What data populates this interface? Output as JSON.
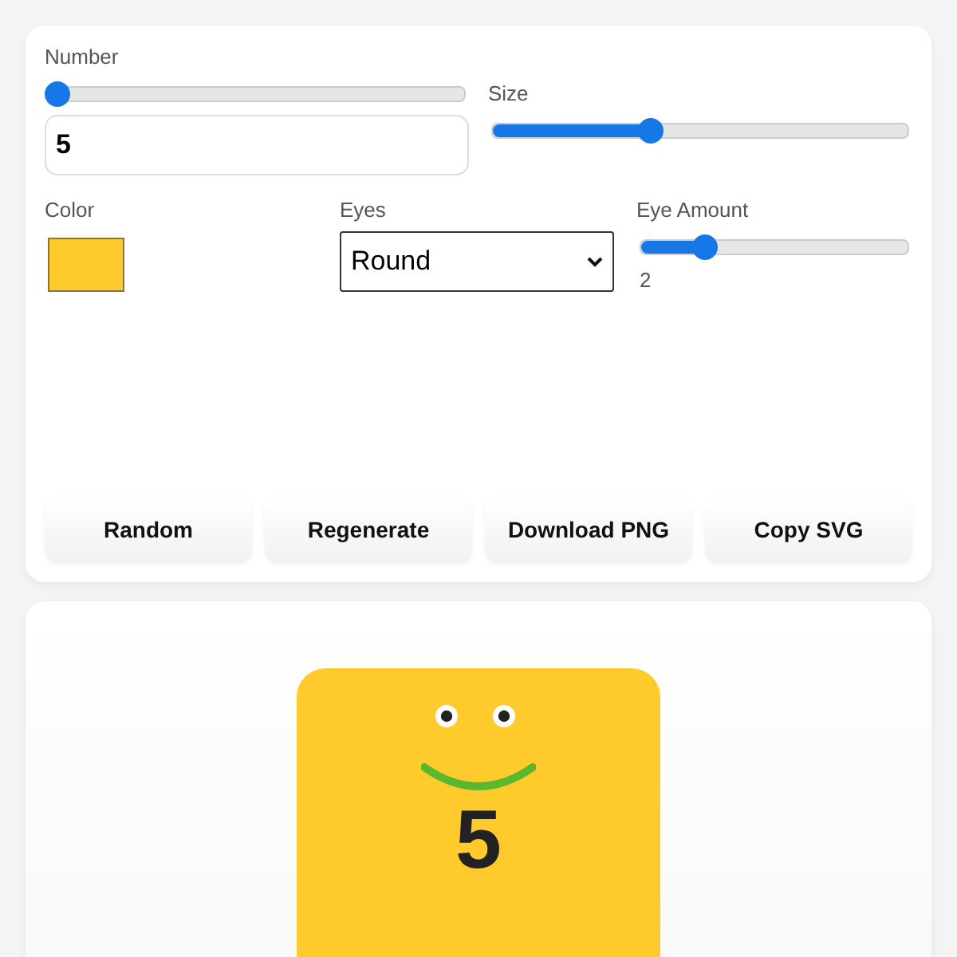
{
  "controls": {
    "number": {
      "label": "Number",
      "level": 0.02,
      "value": "5"
    },
    "size": {
      "label": "Size",
      "level": 0.38
    },
    "color": {
      "label": "Color",
      "color": "#ffca2c"
    },
    "eyes": {
      "label": "Eyes",
      "value": "Round"
    },
    "eye_amount": {
      "label": "Eye Amount",
      "level": 0.24,
      "reading": "2"
    }
  },
  "buttons": [
    "Random",
    "Regenerate",
    "Download PNG",
    "Copy SVG"
  ],
  "preview": {
    "number": "5"
  }
}
